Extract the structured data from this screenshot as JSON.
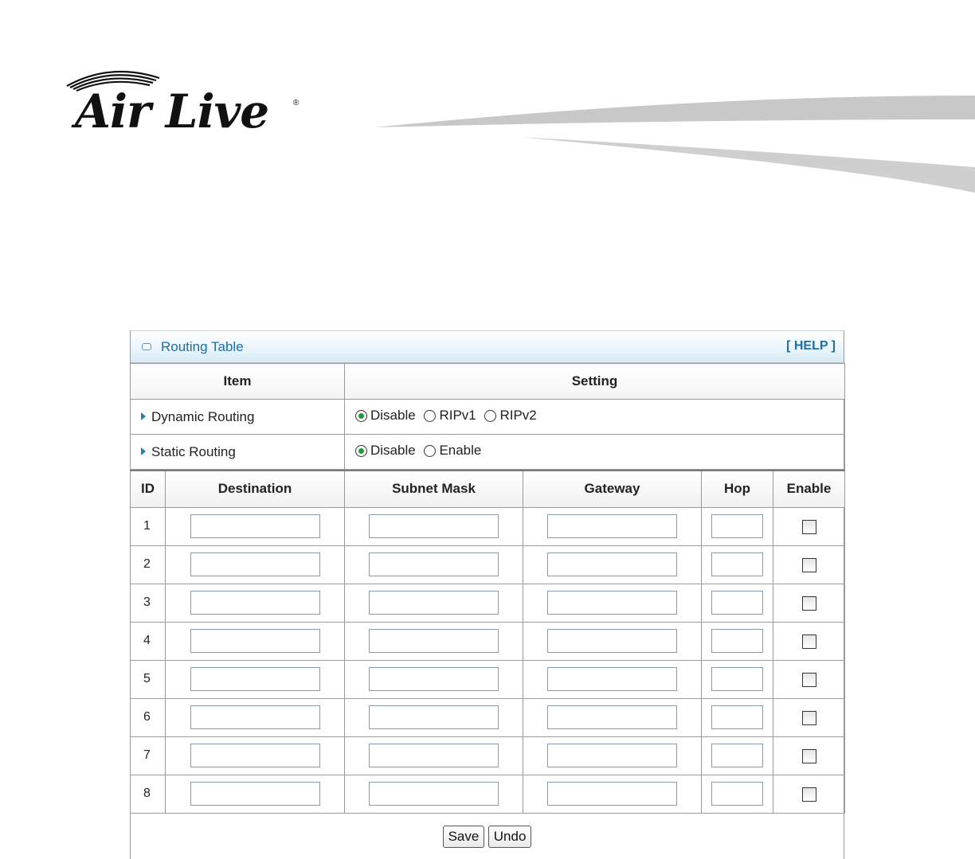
{
  "brand": {
    "logo_text": "Air Live",
    "registered_mark": "®"
  },
  "panel": {
    "title": "Routing Table",
    "help_link": "[ HELP ]",
    "title_color": "#1d6ea6"
  },
  "settings": {
    "headers": {
      "item": "Item",
      "setting": "Setting"
    },
    "dynamic_routing": {
      "label": "Dynamic Routing",
      "options": [
        "Disable",
        "RIPv1",
        "RIPv2"
      ],
      "selected": "Disable"
    },
    "static_routing": {
      "label": "Static Routing",
      "options": [
        "Disable",
        "Enable"
      ],
      "selected": "Disable"
    }
  },
  "routes": {
    "headers": {
      "id": "ID",
      "destination": "Destination",
      "subnet_mask": "Subnet Mask",
      "gateway": "Gateway",
      "hop": "Hop",
      "enable": "Enable"
    },
    "rows": [
      {
        "id": "1",
        "destination": "",
        "subnet_mask": "",
        "gateway": "",
        "hop": "",
        "enabled": false
      },
      {
        "id": "2",
        "destination": "",
        "subnet_mask": "",
        "gateway": "",
        "hop": "",
        "enabled": false
      },
      {
        "id": "3",
        "destination": "",
        "subnet_mask": "",
        "gateway": "",
        "hop": "",
        "enabled": false
      },
      {
        "id": "4",
        "destination": "",
        "subnet_mask": "",
        "gateway": "",
        "hop": "",
        "enabled": false
      },
      {
        "id": "5",
        "destination": "",
        "subnet_mask": "",
        "gateway": "",
        "hop": "",
        "enabled": false
      },
      {
        "id": "6",
        "destination": "",
        "subnet_mask": "",
        "gateway": "",
        "hop": "",
        "enabled": false
      },
      {
        "id": "7",
        "destination": "",
        "subnet_mask": "",
        "gateway": "",
        "hop": "",
        "enabled": false
      },
      {
        "id": "8",
        "destination": "",
        "subnet_mask": "",
        "gateway": "",
        "hop": "",
        "enabled": false
      }
    ]
  },
  "buttons": {
    "save": "Save",
    "undo": "Undo"
  }
}
